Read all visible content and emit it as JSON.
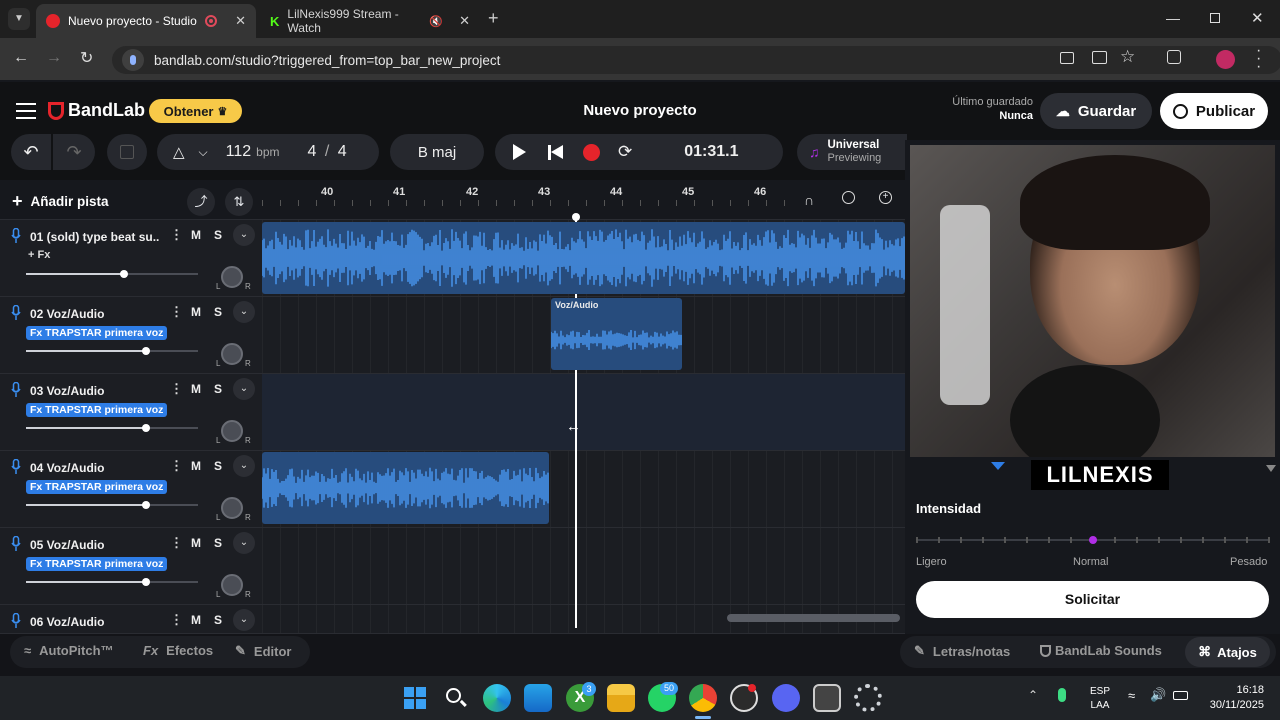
{
  "browser": {
    "tabs": [
      {
        "title": "Nuevo proyecto - Studio",
        "active": true
      },
      {
        "title": "LilNexis999 Stream - Watch",
        "active": false
      }
    ],
    "url": "bandlab.com/studio?triggered_from=top_bar_new_project"
  },
  "app": {
    "brand": "BandLab",
    "get_button": "Obtener",
    "project_title": "Nuevo proyecto",
    "last_saved_label": "Último guardado",
    "last_saved_value": "Nunca",
    "save_button": "Guardar",
    "publish_button": "Publicar"
  },
  "toolbar": {
    "tempo_value": "112",
    "tempo_unit": "bpm",
    "time_sig_num": "4",
    "time_sig_sep": "/",
    "time_sig_den": "4",
    "key": "B maj",
    "time": "01:31.1",
    "preset_name": "Universal",
    "preset_status": "Previewing"
  },
  "timeline": {
    "add_track": "Añadir pista",
    "ruler": [
      "40",
      "41",
      "42",
      "43",
      "44",
      "45",
      "46"
    ]
  },
  "tracks": [
    {
      "name": "01  (sold) type beat su...",
      "fx": "+ Fx",
      "fx_style": "plain",
      "volume": 0.57
    },
    {
      "name": "02  Voz/Audio",
      "fx": "Fx TRAPSTAR primera voz",
      "fx_style": "badge",
      "volume": 0.7
    },
    {
      "name": "03  Voz/Audio",
      "fx": "Fx TRAPSTAR primera voz",
      "fx_style": "badge",
      "volume": 0.7
    },
    {
      "name": "04  Voz/Audio",
      "fx": "Fx TRAPSTAR primera voz",
      "fx_style": "badge",
      "volume": 0.7
    },
    {
      "name": "05  Voz/Audio",
      "fx": "Fx TRAPSTAR primera voz",
      "fx_style": "badge",
      "volume": 0.7
    },
    {
      "name": "06  Voz/Audio",
      "fx": "",
      "fx_style": "plain",
      "volume": 0.7
    }
  ],
  "track_buttons": {
    "mute": "M",
    "solo": "S",
    "left": "L",
    "right": "R"
  },
  "clip_label": "Voz/Audio",
  "webcam": {
    "overlay_text": "LILNEXIS"
  },
  "intensity": {
    "label": "Intensidad",
    "levels": [
      "Ligero",
      "Normal",
      "Pesado"
    ],
    "selected": "Normal",
    "button": "Solicitar"
  },
  "bottom_bar": {
    "autopitch": "AutoPitch™",
    "effects": "Efectos",
    "effects_prefix": "Fx",
    "editor": "Editor",
    "lyrics": "Letras/notas",
    "sounds": "BandLab Sounds",
    "shortcuts": "Atajos"
  },
  "taskbar": {
    "lang": "ESP",
    "region": "LAA",
    "time": "16:18",
    "date": "30/11/2025",
    "xbox_badge": "3",
    "whatsapp_badge": "50"
  },
  "colors": {
    "accent_blue": "#2e7de6",
    "record_red": "#e5242b",
    "get_yellow": "#f7c948",
    "intensity_purple": "#b02ee6"
  }
}
